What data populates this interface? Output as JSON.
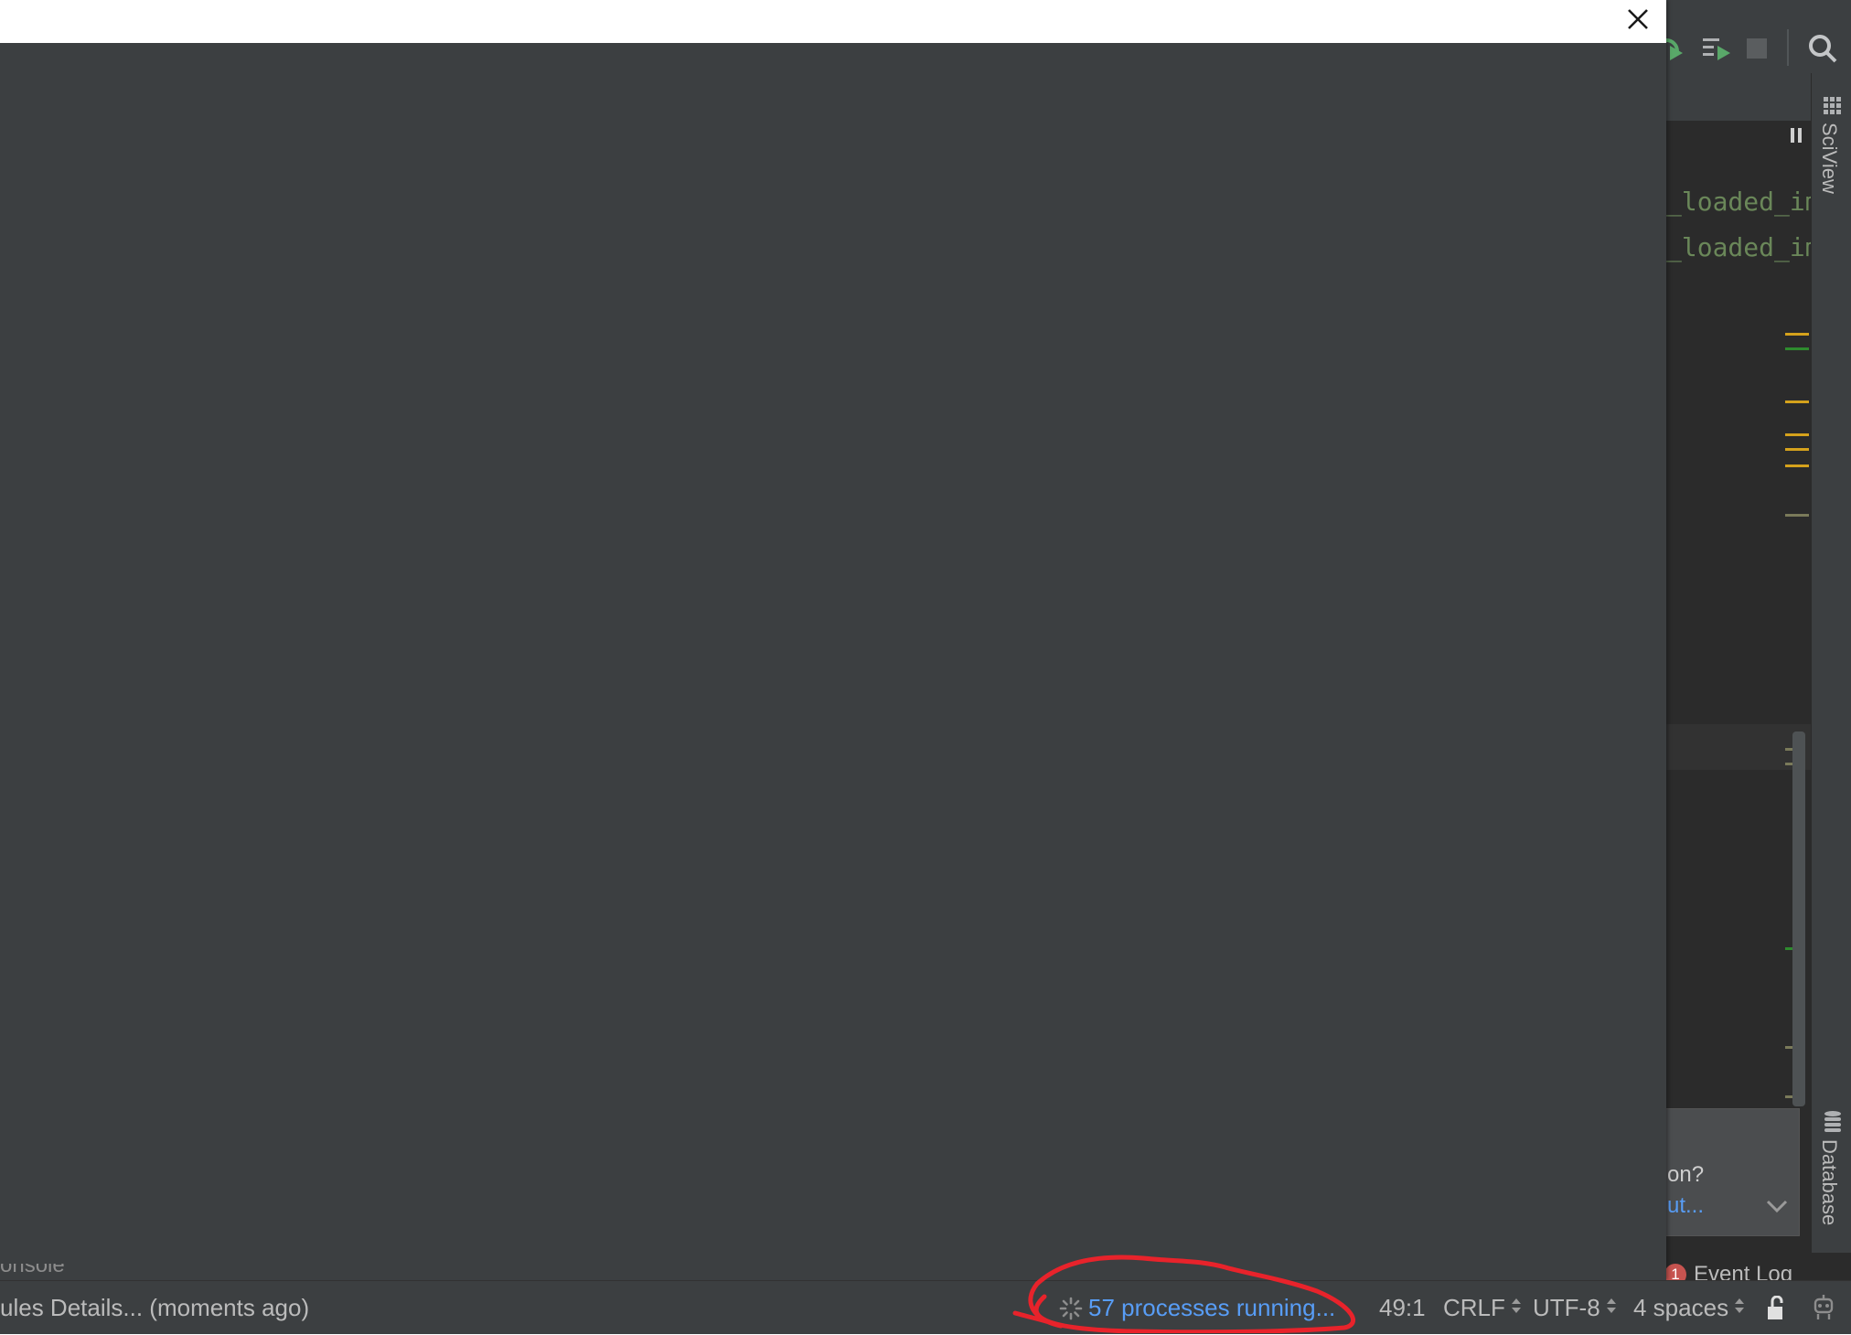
{
  "ide": {
    "code_lines": [
      "_loaded_im",
      "_loaded_im"
    ],
    "sidebar_tabs": {
      "sciview": "SciView",
      "database": "Database"
    },
    "notification": {
      "line1": "on?",
      "line2": "ut..."
    },
    "event_log": {
      "badge_count": "1",
      "label": "Event Log"
    },
    "console_tab_fragment": "onsole"
  },
  "dialog": {
    "close_icon": "close-icon"
  },
  "statusbar": {
    "message": "ules Details... (moments ago)",
    "processes": "57 processes running...",
    "position": "49:1",
    "line_separator": "CRLF",
    "encoding": "UTF-8",
    "indent": "4 spaces"
  },
  "colors": {
    "dialog_bg": "#3c3f41",
    "link_blue": "#589df6",
    "annotation_red": "#e8232b",
    "string_green": "#6a8759",
    "marker_yellow": "#d5a21c",
    "marker_green": "#2e8b2e"
  }
}
